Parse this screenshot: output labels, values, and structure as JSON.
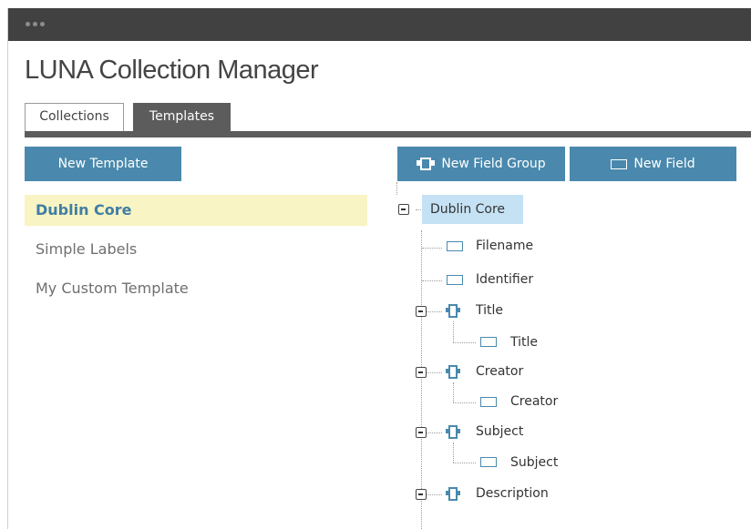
{
  "app": {
    "title": "LUNA Collection Manager"
  },
  "tabs": [
    {
      "label": "Collections",
      "active": false
    },
    {
      "label": "Templates",
      "active": true
    }
  ],
  "toolbar": {
    "new_template_label": "New Template",
    "new_field_group_label": "New Field Group",
    "new_field_label": "New Field"
  },
  "templates": [
    {
      "label": "Dublin Core",
      "selected": true
    },
    {
      "label": "Simple Labels",
      "selected": false
    },
    {
      "label": "My Custom Template",
      "selected": false
    }
  ],
  "tree": {
    "root": "Dublin Core",
    "nodes": [
      {
        "type": "field",
        "label": "Filename"
      },
      {
        "type": "field",
        "label": "Identifier"
      },
      {
        "type": "group",
        "label": "Title",
        "children": [
          "Title"
        ]
      },
      {
        "type": "group",
        "label": "Creator",
        "children": [
          "Creator"
        ]
      },
      {
        "type": "group",
        "label": "Subject",
        "children": [
          "Subject"
        ]
      },
      {
        "type": "group",
        "label": "Description",
        "children": []
      }
    ]
  },
  "colors": {
    "titlebar": "#414141",
    "accent": "#4a89ad",
    "tab_active": "#5c5c5c",
    "selected_row": "#f8f4c3",
    "selected_text": "#3f7ea3",
    "tree_selected": "#c5e2f4"
  },
  "icons": {
    "field_group": "field-group-icon",
    "field": "field-icon",
    "collapse": "collapse-toggle-icon"
  }
}
